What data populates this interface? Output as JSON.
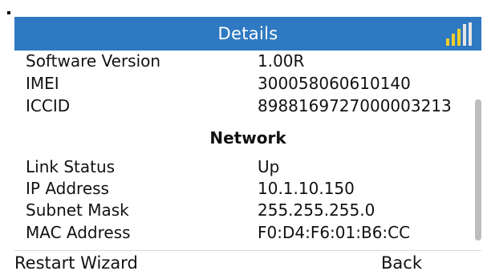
{
  "header": {
    "title": "Details",
    "signal_icon": "signal-strength-icon",
    "accent_color": "#2f79c2"
  },
  "device_info": [
    {
      "label": "Software Version",
      "value": "1.00R"
    },
    {
      "label": "IMEI",
      "value": "300058060610140"
    },
    {
      "label": "ICCID",
      "value": "8988169727000003213"
    }
  ],
  "network": {
    "title": "Network",
    "rows": [
      {
        "label": "Link Status",
        "value": "Up"
      },
      {
        "label": "IP Address",
        "value": "10.1.10.150"
      },
      {
        "label": "Subnet Mask",
        "value": "255.255.255.0"
      },
      {
        "label": "MAC Address",
        "value": "F0:D4:F6:01:B6:CC"
      }
    ]
  },
  "footer": {
    "left_label": "Restart Wizard",
    "right_label": "Back"
  }
}
